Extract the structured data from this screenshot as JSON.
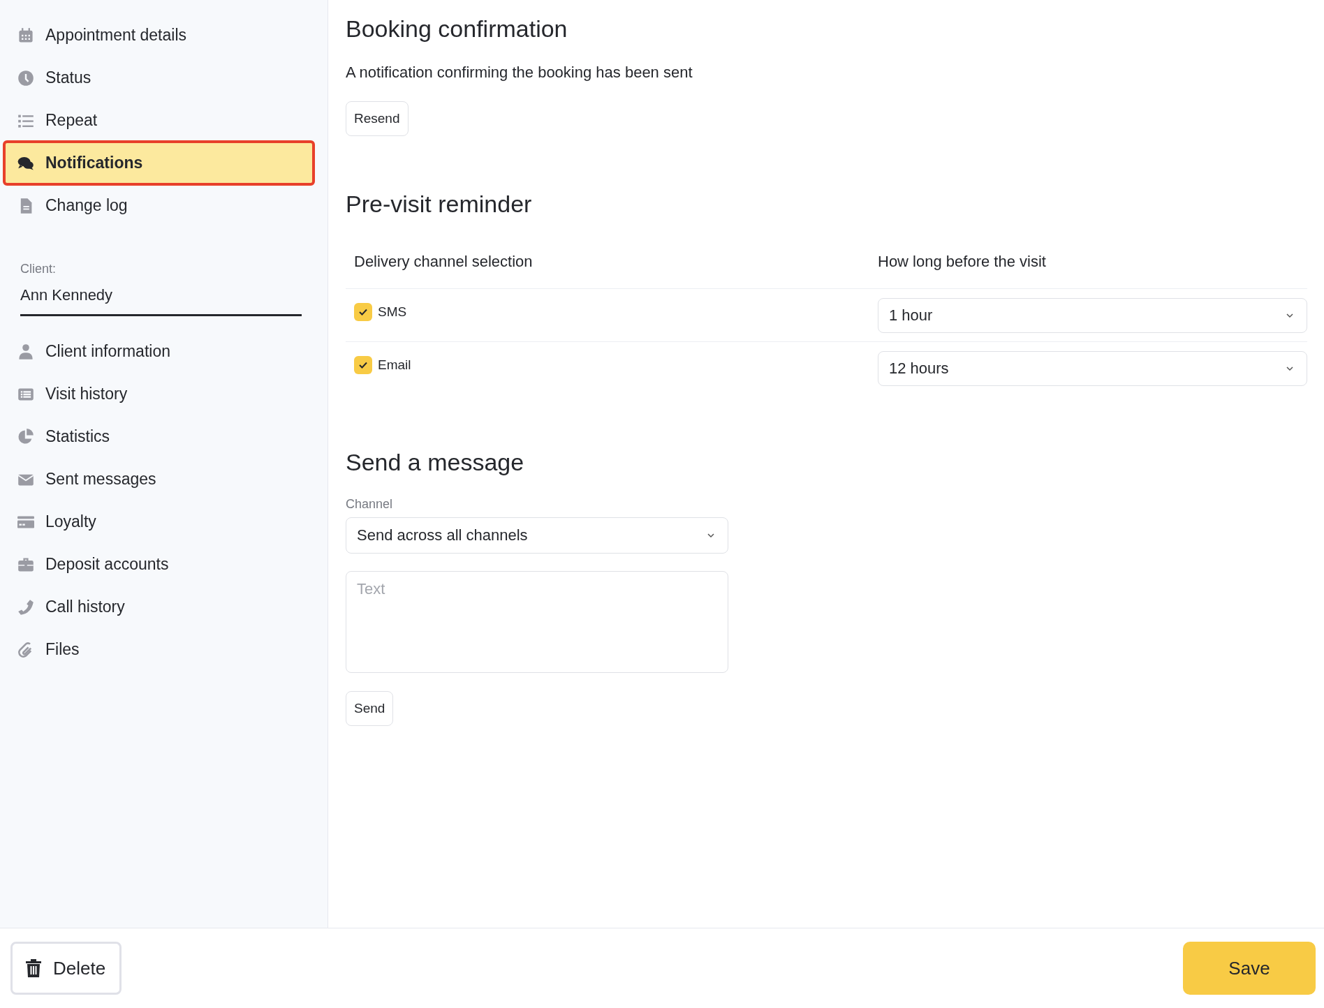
{
  "sidebar": {
    "top_items": [
      {
        "label": "Appointment details",
        "selected": false
      },
      {
        "label": "Status",
        "selected": false
      },
      {
        "label": "Repeat",
        "selected": false
      },
      {
        "label": "Notifications",
        "selected": true
      },
      {
        "label": "Change log",
        "selected": false
      }
    ],
    "client": {
      "label": "Client:",
      "value": "Ann Kennedy"
    },
    "client_items": [
      {
        "label": "Client information",
        "selected": false
      },
      {
        "label": "Visit history",
        "selected": false
      },
      {
        "label": "Statistics",
        "selected": false
      },
      {
        "label": "Sent messages",
        "selected": false
      },
      {
        "label": "Loyalty",
        "selected": false
      },
      {
        "label": "Deposit accounts",
        "selected": false
      },
      {
        "label": "Call history",
        "selected": false
      },
      {
        "label": "Files",
        "selected": false
      }
    ]
  },
  "booking_confirmation": {
    "title": "Booking confirmation",
    "text": "A notification confirming the booking has been sent",
    "button": "Resend"
  },
  "pre_visit_reminder": {
    "title": "Pre-visit reminder",
    "columns": [
      "Delivery channel selection",
      "How long before the visit"
    ],
    "rows": [
      {
        "channel": "SMS",
        "checked": true,
        "time": "1 hour"
      },
      {
        "channel": "Email",
        "checked": true,
        "time": "12 hours"
      }
    ]
  },
  "send_message": {
    "title": "Send a message",
    "channel_label": "Channel",
    "channel_value": "Send across all channels",
    "text_placeholder": "Text",
    "button": "Send"
  },
  "footer": {
    "delete_button": "Delete",
    "save_button": "Save"
  }
}
